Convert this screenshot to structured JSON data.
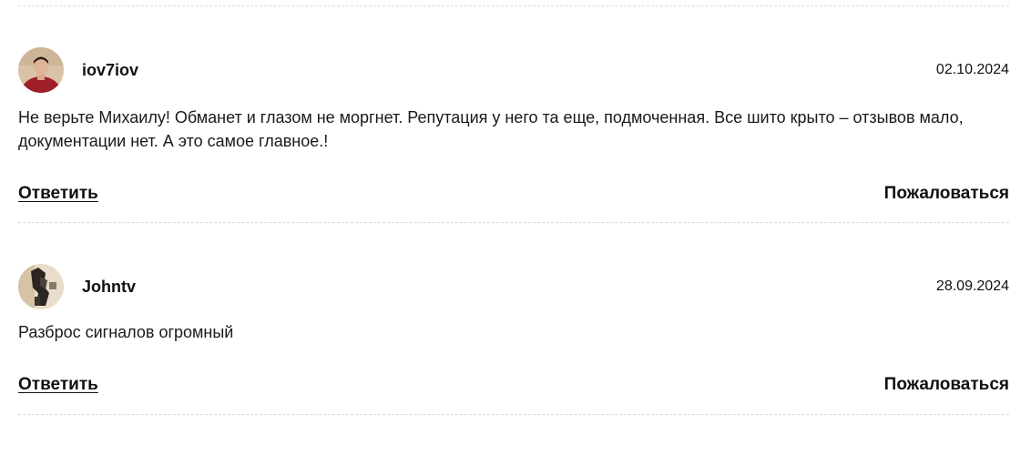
{
  "comments": [
    {
      "username": "iov7iov",
      "date": "02.10.2024",
      "text": "Не верьте Михаилу! Обманет и глазом не моргнет. Репутация у него та еще, подмоченная. Все шито крыто – отзывов мало, документации нет. А это самое главное.!",
      "reply_label": "Ответить",
      "report_label": "Пожаловаться"
    },
    {
      "username": "Johntv",
      "date": "28.09.2024",
      "text": "Разброс сигналов огромный",
      "reply_label": "Ответить",
      "report_label": "Пожаловаться"
    }
  ]
}
